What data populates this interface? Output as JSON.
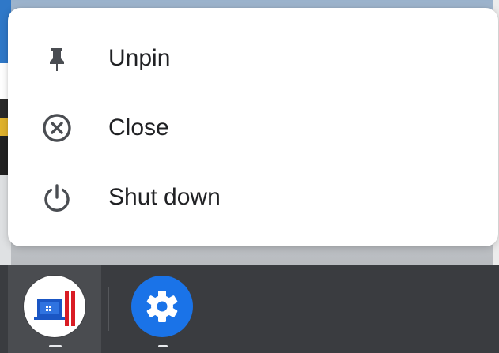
{
  "context_menu": {
    "items": [
      {
        "label": "Unpin",
        "icon": "pin-icon"
      },
      {
        "label": "Close",
        "icon": "close-circle-icon"
      },
      {
        "label": "Shut down",
        "icon": "power-icon"
      }
    ]
  },
  "shelf": {
    "apps": [
      {
        "icon": "remote-desktop-app-icon",
        "running": true
      },
      {
        "icon": "settings-app-icon",
        "running": true
      }
    ]
  },
  "colors": {
    "menu_background": "#ffffff",
    "menu_text": "#202124",
    "shelf_background": "#3a3c40",
    "settings_blue": "#1a73e8"
  }
}
